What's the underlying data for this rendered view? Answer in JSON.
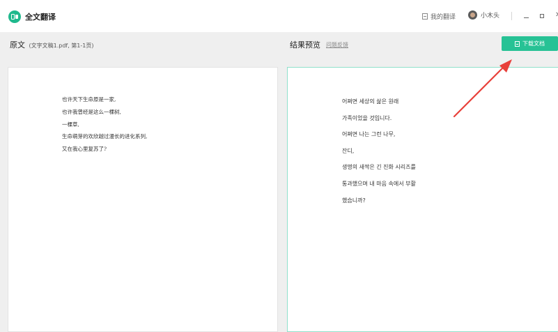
{
  "app": {
    "name": "全文翻译",
    "brand_color": "#1fb98d"
  },
  "titlebar": {
    "my_translations": "我的翻译",
    "username": "小木头",
    "window_controls": [
      "minimize-icon",
      "maximize-icon",
      "close-icon"
    ]
  },
  "original": {
    "title": "原文",
    "subtitle": "(文字文稿1.pdf, 第1-1页)",
    "lines": [
      "也许天下生命原是一家,",
      "也许我曾经是这么一棵树,",
      "一棵草,",
      "生命萌芽的欢欣越过漫长的进化系列,",
      "又在我心里复苏了?"
    ]
  },
  "result": {
    "title": "结果预览",
    "feedback_link": "问题反馈",
    "download_label": "下载文档",
    "accent_color": "#27c295",
    "lines": [
      "어쩌면 세상의 삶은 원래",
      "가족이었을 것입니다.",
      "어쩌면 나는 그런 나무,",
      "잔디,",
      "생명의 새싹은 긴 진화 시리즈를",
      "통과했으며 내 마음 속에서 부활",
      "했습니까?"
    ]
  },
  "annotation": {
    "arrow_color": "#e8403a"
  }
}
